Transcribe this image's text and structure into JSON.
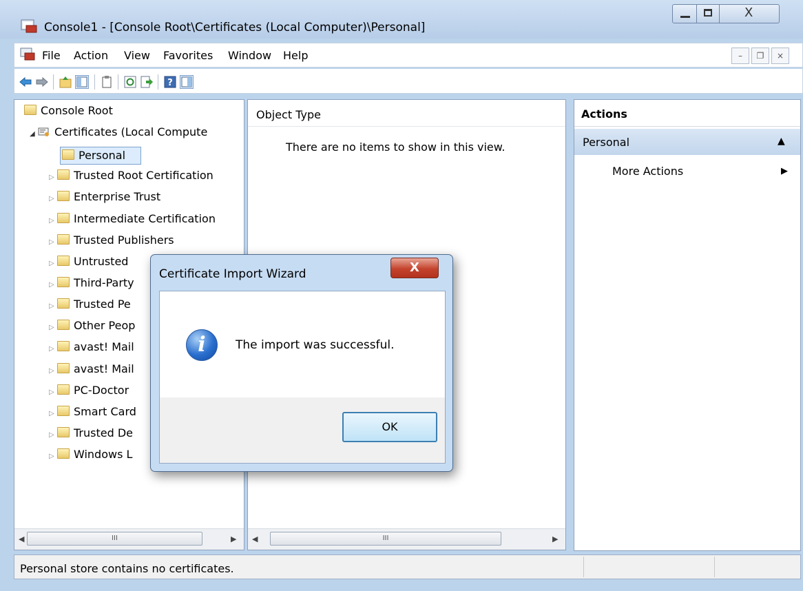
{
  "window": {
    "title": "Console1 - [Console Root\\Certificates (Local Computer)\\Personal]",
    "icon": "mmc-console-icon"
  },
  "menu": [
    "File",
    "Action",
    "View",
    "Favorites",
    "Window",
    "Help"
  ],
  "tree": {
    "root": "Console Root",
    "certificates": "Certificates (Local Compute",
    "items": [
      "Personal",
      "Trusted Root Certification",
      "Enterprise Trust",
      "Intermediate Certification",
      "Trusted Publishers",
      "Untrusted",
      "Third-Party",
      "Trusted Pe",
      "Other Peop",
      "avast! Mail",
      "avast! Mail",
      "PC-Doctor",
      "Smart Card",
      "Trusted De",
      "Windows L"
    ]
  },
  "middle": {
    "column_header": "Object Type",
    "empty_text": "There are no items to show in this view."
  },
  "actions": {
    "header": "Actions",
    "section": "Personal",
    "more": "More Actions"
  },
  "status": {
    "text": "Personal store contains no certificates."
  },
  "dialog": {
    "title": "Certificate Import Wizard",
    "message": "The import was successful.",
    "ok_label": "OK",
    "close_glyph": "X",
    "info_glyph": "i"
  },
  "scroll": {
    "thumb_glyph": "III"
  }
}
